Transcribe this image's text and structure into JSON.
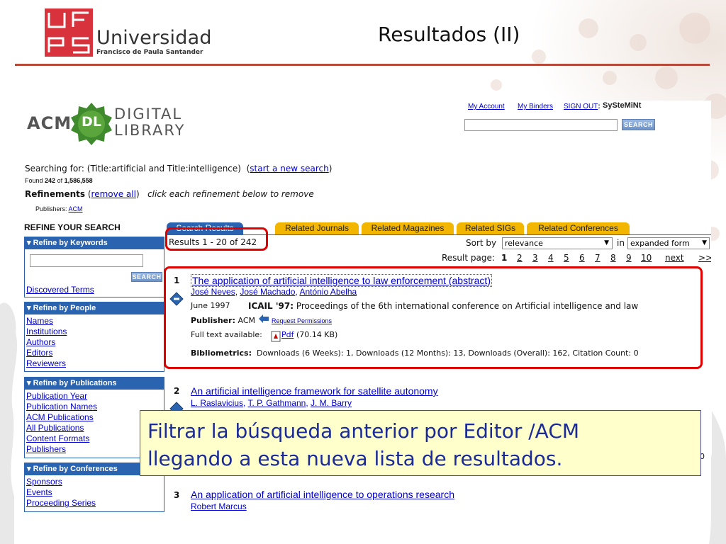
{
  "slide": {
    "uni_name": "Universidad",
    "uni_sub": "Francisco de Paula Santander",
    "title": "Resultados (II)"
  },
  "acm": {
    "logo_acm": "ACM",
    "logo_dl": "DL",
    "logo_digital": "DIGITAL",
    "logo_library": "LIBRARY",
    "top_links": [
      "My Account",
      "My Binders",
      "SIGN OUT"
    ],
    "user": "SySteMiNt",
    "search_button": "SEARCH",
    "searching_label": "Searching for:",
    "searching_query": "(Title:artificial and Title:intelligence)",
    "start_new": "start a new search",
    "found_prefix": "Found",
    "found_count": "242",
    "found_of": "of",
    "found_total": "1,586,558",
    "refinements_label": "Refinements",
    "remove_all": "remove all",
    "refinements_hint": "click each refinement below to remove",
    "publishers_label": "Publishers:",
    "publishers_value": "ACM",
    "refine_heading": "REFINE YOUR SEARCH",
    "tabs": [
      "Search Results",
      "Related Journals",
      "Related Magazines",
      "Related SIGs",
      "Related Conferences"
    ],
    "results_range": "Results 1 - 20 of 242",
    "sort_by_label": "Sort by",
    "sort_value": "relevance",
    "in_label": "in",
    "form_value": "expanded form",
    "result_page_label": "Result page:",
    "pages": [
      "1",
      "2",
      "3",
      "4",
      "5",
      "6",
      "7",
      "8",
      "9",
      "10"
    ],
    "next_label": "next",
    "last_label": ">>"
  },
  "sidebar": {
    "keywords": {
      "heading": "Refine by Keywords",
      "search_button": "SEARCH",
      "discovered": "Discovered Terms"
    },
    "people": {
      "heading": "Refine by People",
      "items": [
        "Names",
        "Institutions",
        "Authors",
        "Editors",
        "Reviewers"
      ]
    },
    "publications": {
      "heading": "Refine by Publications",
      "items": [
        "Publication Year",
        "Publication Names",
        "ACM Publications",
        "All Publications",
        "Content Formats",
        "Publishers"
      ]
    },
    "conferences": {
      "heading": "Refine by Conferences",
      "items": [
        "Sponsors",
        "Events",
        "Proceeding Series"
      ]
    }
  },
  "results": [
    {
      "num": "1",
      "title": "The application of artificial intelligence to law enforcement (abstract)",
      "authors": [
        "José Neves",
        "José Machado",
        "António Abelha"
      ],
      "date": "June 1997",
      "venue_short": "ICAIL '97:",
      "venue_long": "Proceedings of the 6th international conference on Artificial intelligence and law",
      "publisher_label": "Publisher:",
      "publisher": "ACM",
      "permissions": "Request Permissions",
      "fulltext_label": "Full text available:",
      "pdf_label": "Pdf",
      "pdf_size": "(70.14 KB)",
      "biblio_label": "Bibliometrics:",
      "biblio_text": "Downloads (6 Weeks): 1,   Downloads (12 Months): 13,   Downloads (Overall): 162,    Citation Count: 0"
    },
    {
      "num": "2",
      "title": "An artificial intelligence framework for satellite autonomy",
      "authors": [
        "L. Raslavicius",
        "T. P. Gathmann",
        "J. M. Barry"
      ],
      "trailing_digit": "0"
    },
    {
      "num": "3",
      "title": "An application of artificial intelligence to operations research",
      "authors": [
        "Robert Marcus"
      ]
    }
  ],
  "caption": {
    "line1": "Filtrar la búsqueda anterior por Editor /ACM",
    "line2": "llegando a esta nueva lista de resultados."
  },
  "colors": {
    "accent_red": "#e00000",
    "acm_blue": "#2a64b0",
    "tab_gold": "#f2b600",
    "logo_red": "#d8323c",
    "dl_green": "#5aa53c",
    "caption_bg": "#ffffcc",
    "caption_text": "#1a2a99"
  }
}
